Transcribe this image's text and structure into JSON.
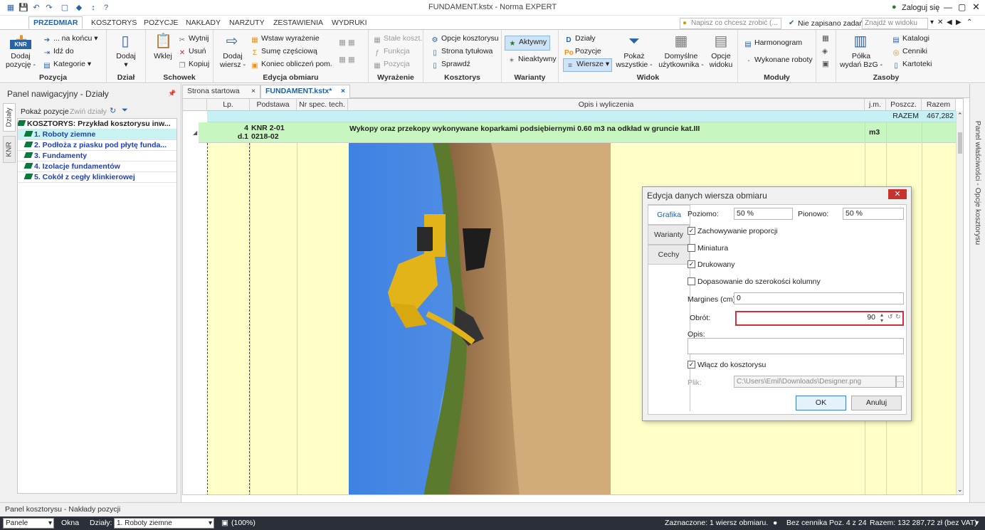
{
  "window": {
    "title": "FUNDAMENT.kstx - Norma EXPERT",
    "login": "Zaloguj się",
    "unsaved": "Nie zapisano zadań",
    "tell_me": "Napisz co chcesz zrobić (...",
    "find_in_view": "Znajdź w widoku"
  },
  "tabs": [
    "PRZEDMIAR",
    "KOSZTORYS",
    "POZYCJE",
    "NAKŁADY",
    "NARZUTY",
    "ZESTAWIENIA",
    "WYDRUKI"
  ],
  "ribbon": {
    "pozycja": {
      "label": "Pozycja",
      "add": "Dodaj pozycję",
      "add_sub": "pozycję -",
      "on_end": "... na końcu",
      "go_to": "Idź do",
      "categories": "Kategorie"
    },
    "dzial": {
      "label": "Dział",
      "add": "Dodaj"
    },
    "schowek": {
      "label": "Schowek",
      "paste": "Wklej",
      "cut": "Wytnij",
      "delete": "Usuń",
      "copy": "Kopiuj"
    },
    "edycja": {
      "label": "Edycja obmiaru",
      "add_row": "Dodaj",
      "add_row2": "wiersz -",
      "insert_expr": "Wstaw wyrażenie",
      "partial_sum": "Sumę częściową",
      "end_calc": "Koniec obliczeń pom."
    },
    "wyrazenie": {
      "label": "Wyrażenie",
      "const": "Stałe koszt.",
      "func": "Funkcja",
      "pos": "Pozycja"
    },
    "kosztorys": {
      "label": "Kosztorys",
      "options": "Opcje kosztorysu",
      "title_page": "Strona tytułowa",
      "check": "Sprawdź"
    },
    "warianty": {
      "label": "Warianty",
      "active": "Aktywny",
      "inactive": "Nieaktywny"
    },
    "widok": {
      "label": "Widok",
      "dzialy": "Działy",
      "pozycje": "Pozycje",
      "wiersze": "Wiersze",
      "show_all": "Pokaż",
      "show_all2": "wszystkie -",
      "default": "Domyślne",
      "default2": "użytkownika -",
      "options": "Opcje",
      "options2": "widoku"
    },
    "moduly": {
      "label": "Moduły",
      "schedule": "Harmonogram",
      "done": "Wykonane roboty"
    },
    "zasoby": {
      "label": "Zasoby",
      "shelf": "Półka",
      "shelf2": "wydań BzG -",
      "catalogs": "Katalogi",
      "prices": "Cenniki",
      "cards": "Kartoteki"
    }
  },
  "nav_panel": {
    "title": "Panel nawigacyjny - Działy",
    "show_positions": "Pokaż pozycje",
    "collapse": "Zwiń działy",
    "vtabs": [
      "Działy",
      "KNR"
    ],
    "tree": [
      "KOSZTORYS: Przykład kosztorysu inw...",
      "1. Roboty ziemne",
      "2. Podłoża z piasku pod płytę funda...",
      "3. Fundamenty",
      "4. Izolacje fundamentów",
      "5. Cokół z cegły klinkierowej"
    ]
  },
  "doc_tabs": [
    "Strona startowa",
    "FUNDAMENT.kstx*"
  ],
  "grid": {
    "headers": [
      "Lp.",
      "Podstawa",
      "Nr spec. tech.",
      "Opis i wyliczenia",
      "j.m.",
      "Poszcz.",
      "Razem"
    ],
    "razem_label": "RAZEM",
    "razem_value": "467,282",
    "row": {
      "lp": "4",
      "lp2": "d.1",
      "basis": "KNR 2-01",
      "basis2": "0218-02",
      "desc": "Wykopy oraz przekopy wykonywane koparkami podsiębiernymi 0.60 m3 na odkład w gruncie kat.III",
      "unit": "m3"
    }
  },
  "right_rail": "Panel właściwości - Opcje kosztorysu",
  "dialog": {
    "title": "Edycja danych wiersza obmiaru",
    "tabs": [
      "Grafika",
      "Warianty",
      "Cechy"
    ],
    "poziomo_label": "Poziomo:",
    "poziomo": "50 %",
    "pionowo_label": "Pionowo:",
    "pionowo": "50 %",
    "keep_ratio": "Zachowywanie proporcji",
    "thumbnail": "Miniatura",
    "printed": "Drukowany",
    "fit_width": "Dopasowanie do szerokości kolumny",
    "margin_label": "Margines (cm):",
    "margin": "0",
    "rotation_label": "Obrót:",
    "rotation": "90",
    "desc_label": "Opis:",
    "include": "Włącz do kosztorysu",
    "file_label": "Plik:",
    "file": "C:\\Users\\Emil\\Downloads\\Designer.png",
    "ok": "OK",
    "cancel": "Anuluj"
  },
  "status": {
    "panel": "Panel kosztorysu - Nakłady pozycji",
    "panele": "Panele",
    "okna": "Okna",
    "dzialy_label": "Działy:",
    "dzial_value": "1. Roboty ziemne",
    "zoom": "(100%)",
    "selected": "Zaznaczone: 1 wiersz obmiaru.",
    "pricelist": "Bez cennika",
    "pos": "Poz. 4 z 24",
    "total": "Razem: 132 287,72 zł (bez VAT)"
  }
}
